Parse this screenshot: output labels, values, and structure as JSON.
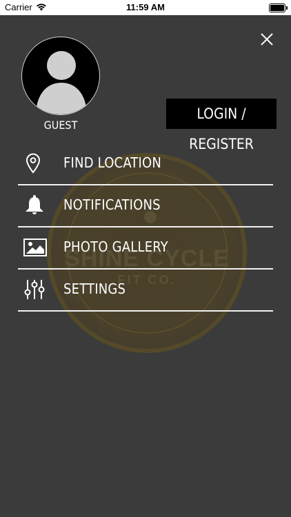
{
  "status_bar": {
    "carrier": "Carrier",
    "time": "11:59 AM"
  },
  "profile": {
    "name": "GUEST",
    "login_label": "LOGIN / REGISTER"
  },
  "menu": [
    {
      "label": "FIND LOCATION",
      "icon": "location-pin-icon"
    },
    {
      "label": "NOTIFICATIONS",
      "icon": "bell-icon"
    },
    {
      "label": "PHOTO GALLERY",
      "icon": "image-icon"
    },
    {
      "label": "SETTINGS",
      "icon": "sliders-icon"
    }
  ],
  "watermark": {
    "brand": "SHINE CYCLE",
    "sub": "FIT CO."
  },
  "colors": {
    "background": "#3b3b3b",
    "accent_dark": "#000000",
    "text": "#ffffff"
  }
}
